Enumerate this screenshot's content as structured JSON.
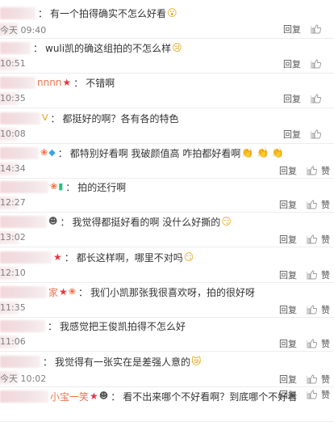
{
  "comments": [
    {
      "visible_name": "",
      "badges": [],
      "text": "有一个拍得确实不怎么好看",
      "emoji": "😮",
      "time": "今天 09:40",
      "reply": "回复",
      "like": ""
    },
    {
      "visible_name": "",
      "badges": [],
      "text": "wuli凯的确这组拍的不怎么样",
      "emoji": "😢",
      "time": "10:51",
      "reply": "回复",
      "like": ""
    },
    {
      "visible_name": "nnnn",
      "badges": [
        "star"
      ],
      "text": "不错啊",
      "emoji": "",
      "time": "10:35",
      "reply": "回复",
      "like": ""
    },
    {
      "visible_name": "",
      "badges": [
        "v"
      ],
      "text": "都挺好的啊？各有各的特色",
      "emoji": "",
      "time": "10:08",
      "reply": "回复",
      "like": ""
    },
    {
      "visible_name": "",
      "badges": [
        "flame",
        "gem"
      ],
      "text": "都特别好看啊   我破颜值高  咋拍都好看啊",
      "emoji": "👏 👏 👏",
      "time": "14:34",
      "reply": "回复",
      "like": "赞"
    },
    {
      "visible_name": "",
      "badges": [
        "flame",
        "vip"
      ],
      "text": "拍的还行啊",
      "emoji": "",
      "time": "12:27",
      "reply": "回复",
      "like": "赞"
    },
    {
      "visible_name": "",
      "badges": [
        "panda"
      ],
      "text": "我觉得都挺好看的啊 没什么好撕的",
      "emoji": "😏",
      "time": "13:02",
      "reply": "回复",
      "like": "赞"
    },
    {
      "visible_name": "",
      "badges": [
        "star"
      ],
      "text": "都长这样啊，哪里不对吗",
      "emoji": "😏",
      "time": "12:10",
      "reply": "回复",
      "like": "赞"
    },
    {
      "visible_name": "家",
      "badges": [
        "star",
        "flame"
      ],
      "text": "我们小凯那张我很喜欢呀，拍的很好呀",
      "emoji": "",
      "time": "11:35",
      "reply": "回复",
      "like": "赞"
    },
    {
      "visible_name": "",
      "badges": [],
      "text": "我感觉把王俊凯拍得不怎么好",
      "emoji": "",
      "time": "11:06",
      "reply": "回复",
      "like": "赞"
    },
    {
      "visible_name": "",
      "badges": [],
      "text": "我觉得有一张实在是差强人意的",
      "emoji": "😿",
      "time": "今天 10:02",
      "reply": "回复",
      "like": "赞"
    },
    {
      "visible_name": "小宝一笑",
      "badges": [
        "star",
        "panda"
      ],
      "text": "看不出来哪个不好看啊？到底哪个不好看",
      "emoji": "",
      "time": "",
      "reply": "回复",
      "like": "赞"
    }
  ]
}
